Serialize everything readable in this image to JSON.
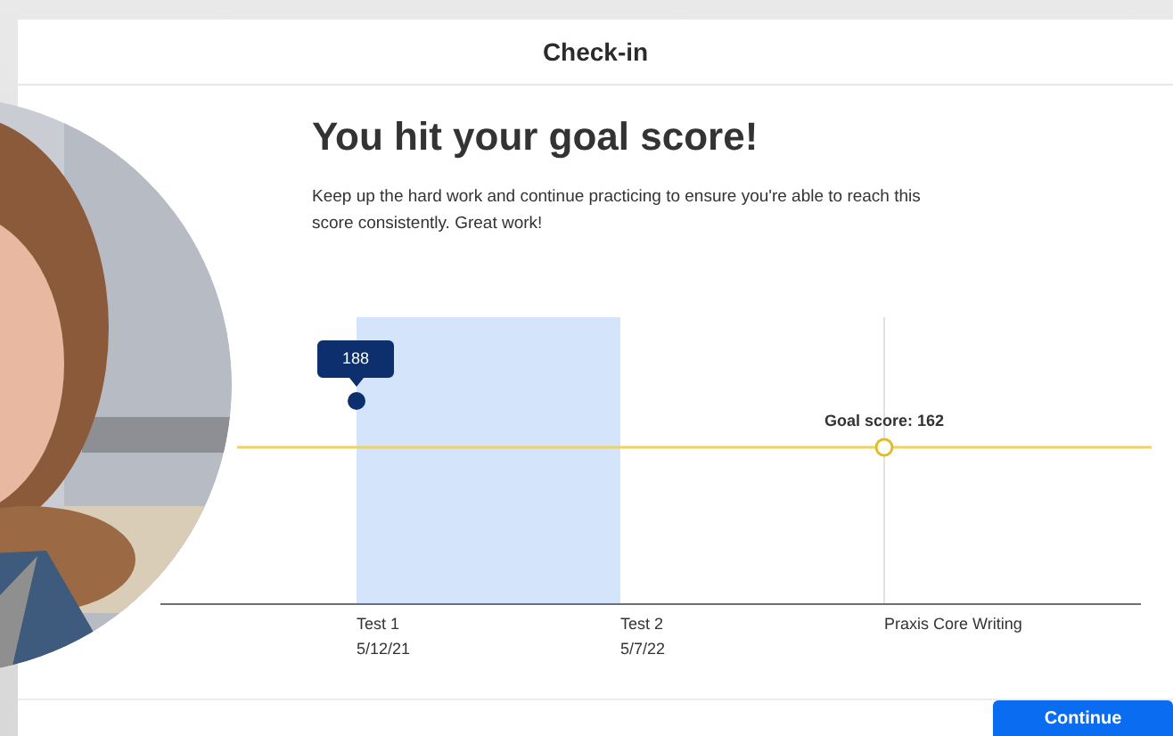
{
  "dialog": {
    "title": "Check-in"
  },
  "headline": "You hit your goal score!",
  "message": "Keep up the hard work and continue practicing to ensure you're able to reach this score consistently. Great work!",
  "chart": {
    "point_label": "188",
    "goal_label": "Goal score: 162",
    "categories": [
      {
        "name": "Test 1",
        "date": "5/12/21"
      },
      {
        "name": "Test 2",
        "date": "5/7/22"
      },
      {
        "name": "Praxis Core Writing"
      }
    ]
  },
  "buttons": [
    {
      "label": "Continue"
    }
  ]
}
